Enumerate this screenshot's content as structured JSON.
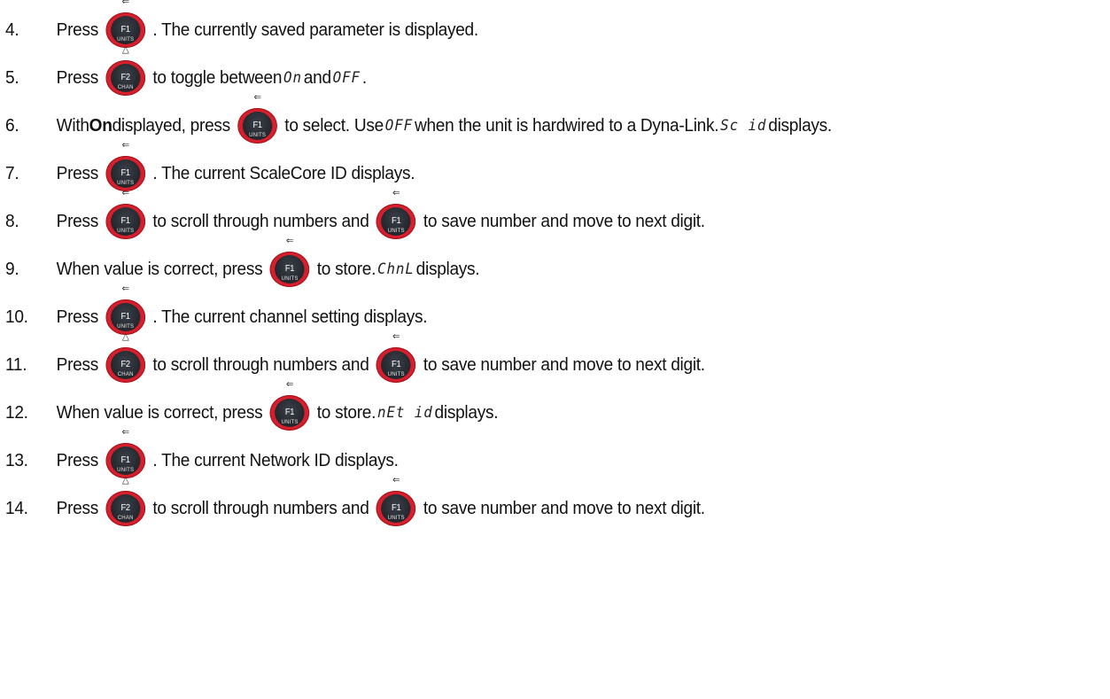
{
  "steps": [
    {
      "num": "4.",
      "parts": [
        {
          "t": "Press"
        },
        {
          "k": "f1"
        },
        {
          "t": ". The currently saved parameter is displayed."
        }
      ]
    },
    {
      "num": "5.",
      "parts": [
        {
          "t": "Press"
        },
        {
          "k": "f2"
        },
        {
          "t": "to toggle between"
        },
        {
          "seg": "On"
        },
        {
          "t": "and"
        },
        {
          "seg": "OFF"
        },
        {
          "t": "."
        }
      ]
    },
    {
      "num": "6.",
      "parts": [
        {
          "t": "With "
        },
        {
          "b": "On"
        },
        {
          "t": " displayed, press"
        },
        {
          "k": "f1"
        },
        {
          "t": "to select. Use"
        },
        {
          "seg": "OFF"
        },
        {
          "t": "when the unit is hardwired to a Dyna-Link."
        },
        {
          "seg": "Sc id"
        },
        {
          "t": "displays."
        }
      ]
    },
    {
      "num": "7.",
      "parts": [
        {
          "t": "Press"
        },
        {
          "k": "f1"
        },
        {
          "t": ". The current ScaleCore ID displays."
        }
      ]
    },
    {
      "num": "8.",
      "parts": [
        {
          "t": "Press"
        },
        {
          "k": "f1"
        },
        {
          "t": "to scroll through numbers and"
        },
        {
          "k": "f1"
        },
        {
          "t": "to save number and move to next digit."
        }
      ]
    },
    {
      "num": "9.",
      "parts": [
        {
          "t": "When value is correct, press"
        },
        {
          "k": "f1"
        },
        {
          "t": "to store."
        },
        {
          "seg": "ChnL"
        },
        {
          "t": "displays."
        }
      ]
    },
    {
      "num": "10.",
      "parts": [
        {
          "t": "Press"
        },
        {
          "k": "f1"
        },
        {
          "t": ". The current channel setting displays."
        }
      ]
    },
    {
      "num": "11.",
      "parts": [
        {
          "t": "Press"
        },
        {
          "k": "f2"
        },
        {
          "t": "to scroll through numbers and"
        },
        {
          "k": "f1"
        },
        {
          "t": "to save number and move to next digit."
        }
      ]
    },
    {
      "num": "12.",
      "parts": [
        {
          "t": "When value is correct, press"
        },
        {
          "k": "f1"
        },
        {
          "t": "to store."
        },
        {
          "seg": "nEt id"
        },
        {
          "t": "displays."
        }
      ]
    },
    {
      "num": "13.",
      "parts": [
        {
          "t": "Press"
        },
        {
          "k": "f1"
        },
        {
          "t": ". The current Network ID displays."
        }
      ]
    },
    {
      "num": "14.",
      "parts": [
        {
          "t": "Press"
        },
        {
          "k": "f2"
        },
        {
          "t": "to scroll through numbers and"
        },
        {
          "k": "f1"
        },
        {
          "t": "to save number and move to next digit."
        }
      ]
    }
  ],
  "keys": {
    "f1": {
      "label": "F1",
      "sub": "UNITS",
      "glyph": "⇐",
      "icon": "enter-arrow-icon"
    },
    "f2": {
      "label": "F2",
      "sub": "CHAN",
      "glyph": "△",
      "icon": "up-triangle-icon"
    }
  },
  "colors": {
    "button_ring": "#d61f2c",
    "button_face": "#23262c",
    "text": "#111111"
  }
}
